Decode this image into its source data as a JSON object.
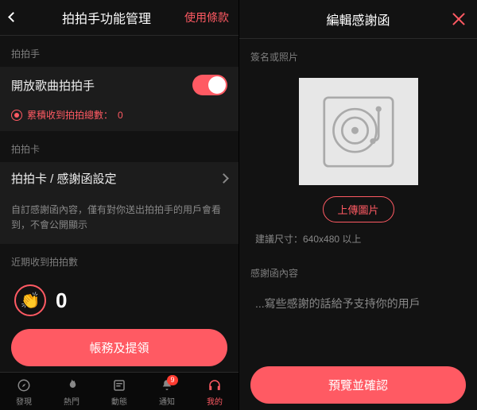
{
  "left": {
    "header": {
      "title": "拍拍手功能管理",
      "terms": "使用條款"
    },
    "clap": {
      "section": "拍拍手",
      "row_title": "開放歌曲拍拍手",
      "total_label": "累積收到拍拍總數：",
      "total_value": "0"
    },
    "card": {
      "section": "拍拍卡",
      "row_title": "拍拍卡 / 感謝函設定",
      "desc": "自訂感謝函內容，僅有對你送出拍拍手的用戶會看到，不會公開顯示"
    },
    "recent": {
      "section": "近期收到拍拍數",
      "count": "0"
    },
    "claim_button": "帳務及提領",
    "tabs": [
      {
        "label": "發現",
        "icon": "compass"
      },
      {
        "label": "熱門",
        "icon": "flame"
      },
      {
        "label": "動態",
        "icon": "feed"
      },
      {
        "label": "通知",
        "icon": "bell",
        "badge": "9"
      },
      {
        "label": "我的",
        "icon": "headphones",
        "active": true
      }
    ]
  },
  "right": {
    "header": {
      "title": "編輯感謝函"
    },
    "sig_section": "簽名或照片",
    "upload": "上傳圖片",
    "size_hint": "建議尺寸：640x480 以上",
    "content_section": "感謝函內容",
    "placeholder": "...寫些感謝的話給予支持你的用戶",
    "confirm": "預覽並確認"
  }
}
